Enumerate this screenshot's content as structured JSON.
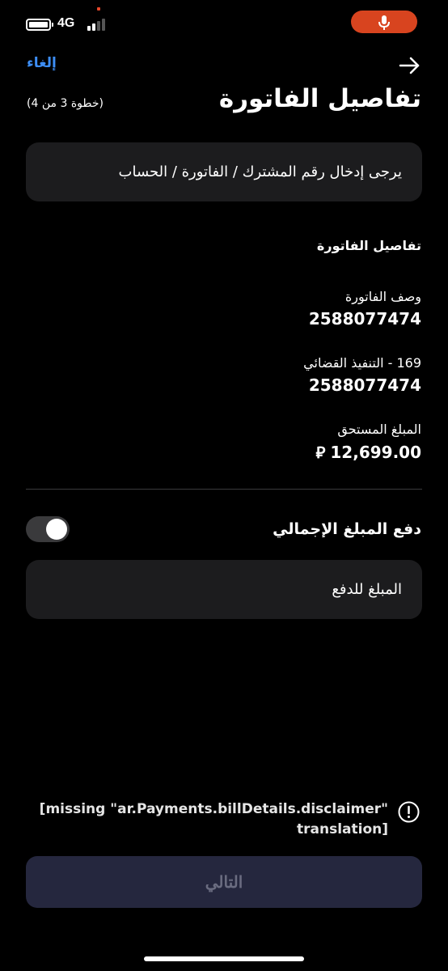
{
  "status_bar": {
    "network": "4G",
    "battery_icon": "battery-full-icon",
    "signal_icon": "cellular-signal-icon",
    "mic_icon": "microphone-icon",
    "mic_pill_color": "#d8441f"
  },
  "header": {
    "back_icon": "arrow-right-icon",
    "cancel_label": "إلغاء",
    "title": "تفاصيل الفاتورة",
    "step": "(خطوة 3 من 4)"
  },
  "subscriber_input": {
    "placeholder": "يرجى إدخال رقم المشترك / الفاتورة / الحساب"
  },
  "bill_details": {
    "section_title": "تفاصيل الفاتورة",
    "items": [
      {
        "label": "وصف الفاتورة",
        "value": "2588077474"
      },
      {
        "label": "169 - التنفيذ القضائي",
        "value": "2588077474"
      },
      {
        "label": "المبلغ المستحق",
        "value": "12,699.00",
        "currency_symbol": "⃁"
      }
    ]
  },
  "pay_full": {
    "label": "دفع المبلغ الإجمالي",
    "enabled": false
  },
  "amount_input": {
    "placeholder": "المبلغ للدفع"
  },
  "disclaimer": {
    "icon": "exclamation-circle-icon",
    "text": "[missing \"ar.Payments.billDetails.disclaimer\" translation]"
  },
  "footer": {
    "next_label": "التالي"
  },
  "colors": {
    "background": "#000000",
    "card": "#1c1c1e",
    "accent_link": "#3d8ef5",
    "button_disabled_bg": "#25273e",
    "button_disabled_text": "#6a6c80"
  }
}
